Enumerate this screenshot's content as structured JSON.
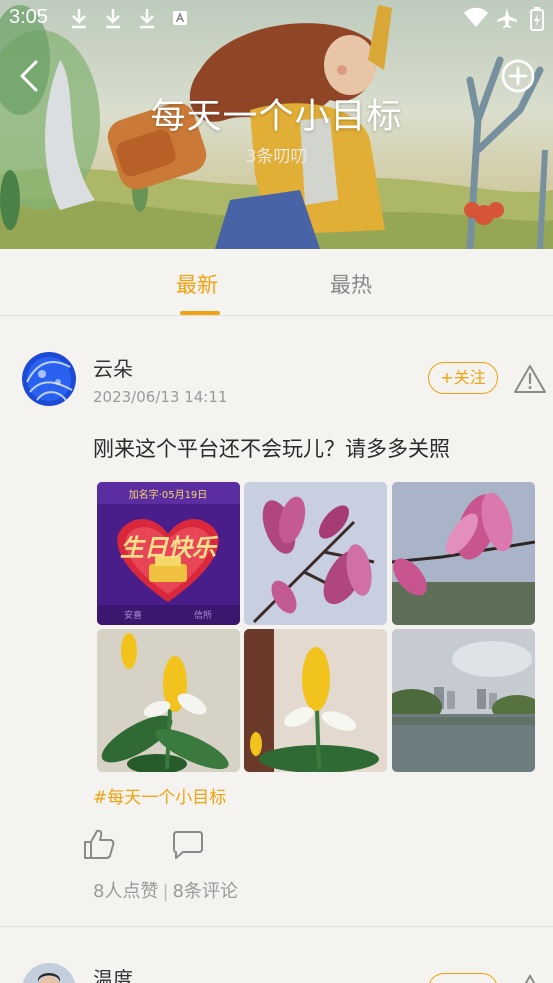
{
  "status_bar": {
    "time": "3:05"
  },
  "header": {
    "title": "每天一个小目标",
    "subtitle": "3条叨叨"
  },
  "tabs": [
    {
      "label": "最新",
      "active": true
    },
    {
      "label": "最热",
      "active": false
    }
  ],
  "post": {
    "username": "云朵",
    "time": "2023/06/13 14:11",
    "follow_label": "+关注",
    "text": "刚来这个平台还不会玩儿？请多多关照",
    "images": [
      {
        "subject": "birthday card",
        "card_top": "加名字·05月19日",
        "card_main": "生日快乐",
        "card_bl": "安喜",
        "card_br": "信所"
      },
      {
        "subject": "magnolia flowers"
      },
      {
        "subject": "magnolia flower"
      },
      {
        "subject": "yellow shrimp plant"
      },
      {
        "subject": "yellow shrimp plant"
      },
      {
        "subject": "river and city skyline"
      }
    ],
    "hashtag": "#每天一个小目标",
    "likes_text": "8人点赞",
    "comments_text": "8条评论"
  },
  "next_post": {
    "username": "温度"
  },
  "colors": {
    "accent": "#f0a311",
    "background": "#f5f3f0",
    "muted_text": "#9a9a9a"
  },
  "icons": [
    "back-arrow-icon",
    "add-circle-icon",
    "warning-icon",
    "thumbs-up-icon",
    "comment-icon",
    "download-icon",
    "wifi-icon",
    "airplane-icon",
    "battery-icon"
  ]
}
